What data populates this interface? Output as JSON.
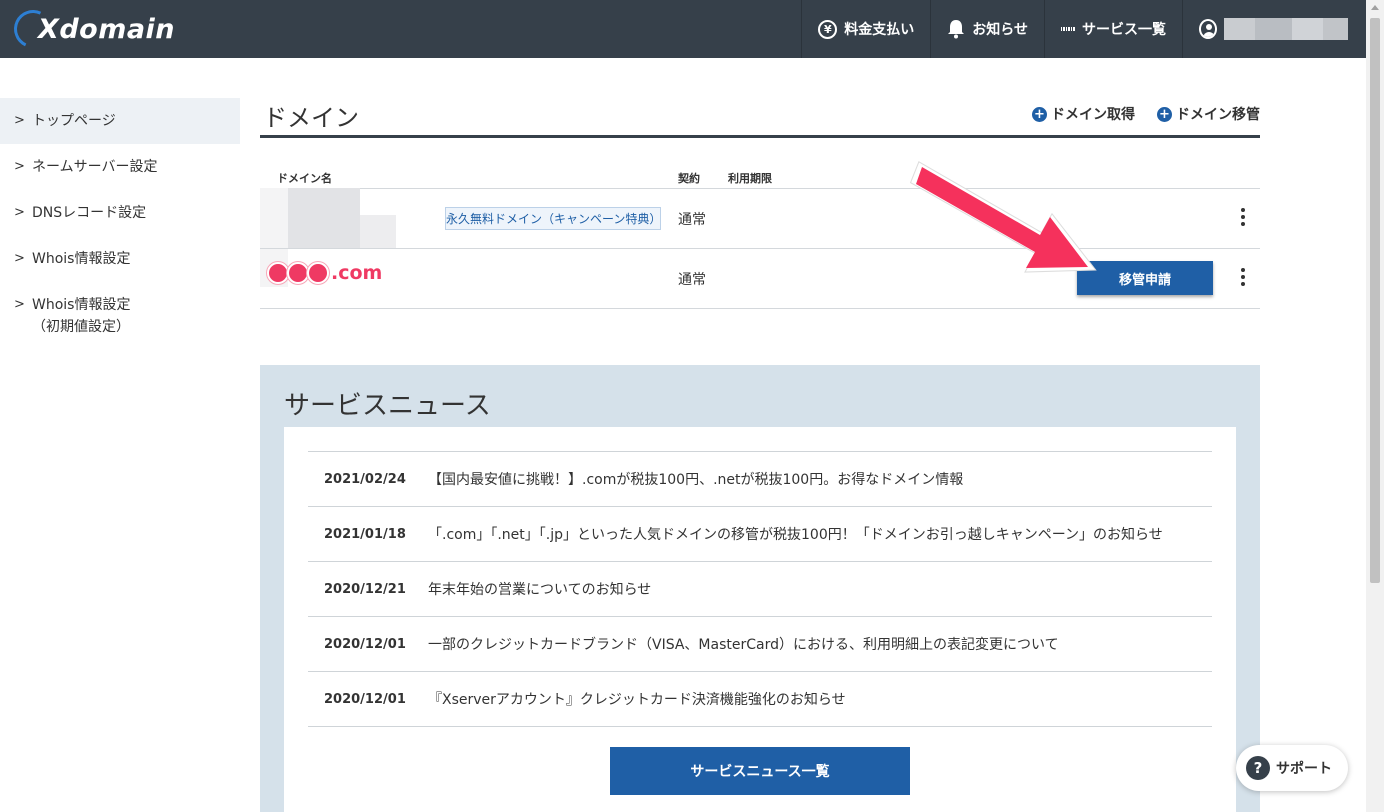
{
  "header": {
    "logo": "Xdomain",
    "nav": [
      {
        "label": "料金支払い",
        "icon": "yen-icon"
      },
      {
        "label": "お知らせ",
        "icon": "bell-icon"
      },
      {
        "label": "サービス一覧",
        "icon": "grid-icon"
      }
    ],
    "user_icon": "user-icon"
  },
  "sidebar": {
    "items": [
      {
        "label": "トップページ"
      },
      {
        "label": "ネームサーバー設定"
      },
      {
        "label": "DNSレコード設定"
      },
      {
        "label": "Whois情報設定"
      },
      {
        "label": "Whois情報設定",
        "sub": "（初期値設定）"
      }
    ]
  },
  "domain": {
    "title": "ドメイン",
    "actions": [
      "ドメイン取得",
      "ドメイン移管"
    ],
    "columns": {
      "name": "ドメイン名",
      "contract": "契約",
      "expiry": "利用期限"
    },
    "rows": [
      {
        "badge": "永久無料ドメイン（キャンペーン特典）",
        "contract": "通常"
      },
      {
        "name": ".com",
        "contract": "通常",
        "action": "移管申請"
      }
    ]
  },
  "news": {
    "title": "サービスニュース",
    "items": [
      {
        "date": "2021/02/24",
        "text": "【国内最安値に挑戦！】.comが税抜100円、.netが税抜100円。お得なドメイン情報"
      },
      {
        "date": "2021/01/18",
        "text": "「.com」「.net」「.jp」といった人気ドメインの移管が税抜100円！「ドメインお引っ越しキャンペーン」のお知らせ"
      },
      {
        "date": "2020/12/21",
        "text": "年末年始の営業についてのお知らせ"
      },
      {
        "date": "2020/12/01",
        "text": "一部のクレジットカードブランド（VISA、MasterCard）における、利用明細上の表記変更について"
      },
      {
        "date": "2020/12/01",
        "text": "『Xserverアカウント』クレジットカード決済機能強化のお知らせ"
      }
    ],
    "button": "サービスニュース一覧"
  },
  "support": {
    "label": "サポート"
  },
  "colors": {
    "header": "#36404a",
    "accent": "#1f5fa6",
    "highlight": "#ef3a63",
    "news_bg": "#d5e1ea"
  }
}
